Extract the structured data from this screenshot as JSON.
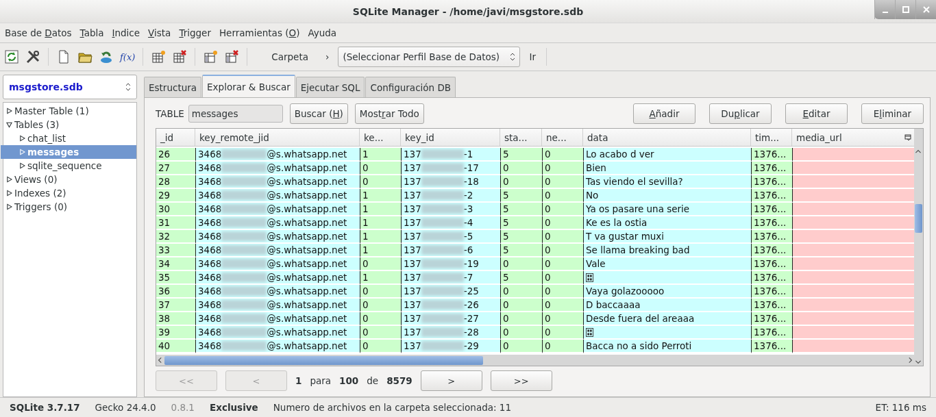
{
  "window": {
    "title": "SQLite Manager - /home/javi/msgstore.sdb"
  },
  "menu": [
    {
      "pre": "Base de ",
      "key": "D",
      "post": "atos"
    },
    {
      "key": "T",
      "post": "abla"
    },
    {
      "key": "I",
      "post": "ndice"
    },
    {
      "key": "V",
      "post": "ista"
    },
    {
      "key": "T",
      "post": "rigger"
    },
    {
      "pre": "Herramientas (",
      "key": "O",
      "post": ")"
    },
    {
      "pre": "Ayuda"
    }
  ],
  "toolbar": {
    "function_label": "f(x)",
    "folder_label": "Carpeta",
    "chevron": "›",
    "profile_select": "(Seleccionar Perfil Base de Datos)",
    "go_label": "Ir"
  },
  "sidebar": {
    "database": "msgstore.sdb",
    "tree": [
      {
        "label": "Master Table (1)",
        "expanded": false,
        "selected": false
      },
      {
        "label": "Tables (3)",
        "expanded": true,
        "selected": false,
        "children": [
          {
            "label": "chat_list",
            "expanded": false,
            "selected": false
          },
          {
            "label": "messages",
            "expanded": false,
            "selected": true
          },
          {
            "label": "sqlite_sequence",
            "expanded": false,
            "selected": false
          }
        ]
      },
      {
        "label": "Views (0)",
        "expanded": false,
        "selected": false
      },
      {
        "label": "Indexes (2)",
        "expanded": false,
        "selected": false
      },
      {
        "label": "Triggers (0)",
        "expanded": false,
        "selected": false
      }
    ]
  },
  "tabs": [
    {
      "label": "Estructura",
      "selected": false
    },
    {
      "label": "Explorar & Buscar",
      "selected": true
    },
    {
      "label": "Ejecutar SQL",
      "selected": false
    },
    {
      "label": "Configuración DB",
      "selected": false
    }
  ],
  "browse": {
    "table_label": "TABLE",
    "table_value": "messages",
    "left_buttons": [
      {
        "pre": "Buscar (",
        "key": "H",
        "post": ")"
      },
      {
        "pre": "Most",
        "key": "r",
        "post": "ar Todo"
      }
    ],
    "right_buttons": [
      {
        "key": "A",
        "post": "ñadir"
      },
      {
        "pre": "Du",
        "key": "p",
        "post": "licar"
      },
      {
        "key": "E",
        "post": "ditar"
      },
      {
        "pre": "E",
        "key": "l",
        "post": "iminar"
      }
    ]
  },
  "table": {
    "columns": [
      {
        "label": "_id",
        "color": "#ccffcc"
      },
      {
        "label": "key_remote_jid",
        "color": "#ccffff"
      },
      {
        "label": "ke...",
        "color": "#ccffcc"
      },
      {
        "label": "key_id",
        "color": "#ccffff"
      },
      {
        "label": "sta...",
        "color": "#ccffcc"
      },
      {
        "label": "ne...",
        "color": "#ccffcc"
      },
      {
        "label": "data",
        "color": "#ccffff"
      },
      {
        "label": "tim...",
        "color": "#ccffcc"
      },
      {
        "label": "media_url",
        "color": "#ffcccc"
      }
    ],
    "rows": [
      {
        "id": "26",
        "jid_start": "3468",
        "jid_end": "@s.whatsapp.net",
        "ke": "1",
        "key_start": "137",
        "key_end": "-1",
        "sta": "5",
        "ne": "0",
        "data": {
          "kind": "text",
          "text": "Lo acabo d ver"
        },
        "tim": "1376..."
      },
      {
        "id": "27",
        "jid_start": "3468",
        "jid_end": "@s.whatsapp.net",
        "ke": "0",
        "key_start": "137",
        "key_end": "-17",
        "sta": "0",
        "ne": "0",
        "data": {
          "kind": "text",
          "text": "Bien"
        },
        "tim": "1376..."
      },
      {
        "id": "28",
        "jid_start": "3468",
        "jid_end": "@s.whatsapp.net",
        "ke": "0",
        "key_start": "137",
        "key_end": "-18",
        "sta": "0",
        "ne": "0",
        "data": {
          "kind": "text",
          "text": "Tas viendo el sevilla?"
        },
        "tim": "1376..."
      },
      {
        "id": "29",
        "jid_start": "3468",
        "jid_end": "@s.whatsapp.net",
        "ke": "1",
        "key_start": "137",
        "key_end": "-2",
        "sta": "5",
        "ne": "0",
        "data": {
          "kind": "text",
          "text": "No"
        },
        "tim": "1376..."
      },
      {
        "id": "30",
        "jid_start": "3468",
        "jid_end": "@s.whatsapp.net",
        "ke": "1",
        "key_start": "137",
        "key_end": "-3",
        "sta": "5",
        "ne": "0",
        "data": {
          "kind": "text",
          "text": "Ya os pasare una serie"
        },
        "tim": "1376..."
      },
      {
        "id": "31",
        "jid_start": "3468",
        "jid_end": "@s.whatsapp.net",
        "ke": "1",
        "key_start": "137",
        "key_end": "-4",
        "sta": "5",
        "ne": "0",
        "data": {
          "kind": "text",
          "text": "Ke es la ostia"
        },
        "tim": "1376..."
      },
      {
        "id": "32",
        "jid_start": "3468",
        "jid_end": "@s.whatsapp.net",
        "ke": "1",
        "key_start": "137",
        "key_end": "-5",
        "sta": "5",
        "ne": "0",
        "data": {
          "kind": "text",
          "text": "T va gustar muxi"
        },
        "tim": "1376..."
      },
      {
        "id": "33",
        "jid_start": "3468",
        "jid_end": "@s.whatsapp.net",
        "ke": "1",
        "key_start": "137",
        "key_end": "-6",
        "sta": "5",
        "ne": "0",
        "data": {
          "kind": "text",
          "text": "Se llama breaking bad"
        },
        "tim": "1376..."
      },
      {
        "id": "34",
        "jid_start": "3468",
        "jid_end": "@s.whatsapp.net",
        "ke": "0",
        "key_start": "137",
        "key_end": "-19",
        "sta": "0",
        "ne": "0",
        "data": {
          "kind": "text",
          "text": "Vale"
        },
        "tim": "1376..."
      },
      {
        "id": "35",
        "jid_start": "3468",
        "jid_end": "@s.whatsapp.net",
        "ke": "1",
        "key_start": "137",
        "key_end": "-7",
        "sta": "5",
        "ne": "0",
        "data": {
          "kind": "glyph"
        },
        "tim": "1376..."
      },
      {
        "id": "36",
        "jid_start": "3468",
        "jid_end": "@s.whatsapp.net",
        "ke": "0",
        "key_start": "137",
        "key_end": "-25",
        "sta": "0",
        "ne": "0",
        "data": {
          "kind": "text",
          "text": "Vaya golazooooo"
        },
        "tim": "1376..."
      },
      {
        "id": "37",
        "jid_start": "3468",
        "jid_end": "@s.whatsapp.net",
        "ke": "0",
        "key_start": "137",
        "key_end": "-26",
        "sta": "0",
        "ne": "0",
        "data": {
          "kind": "text",
          "text": "D baccaaaa"
        },
        "tim": "1376..."
      },
      {
        "id": "38",
        "jid_start": "3468",
        "jid_end": "@s.whatsapp.net",
        "ke": "0",
        "key_start": "137",
        "key_end": "-27",
        "sta": "0",
        "ne": "0",
        "data": {
          "kind": "text",
          "text": "Desde fuera del areaaa"
        },
        "tim": "1376..."
      },
      {
        "id": "39",
        "jid_start": "3468",
        "jid_end": "@s.whatsapp.net",
        "ke": "0",
        "key_start": "137",
        "key_end": "-28",
        "sta": "0",
        "ne": "0",
        "data": {
          "kind": "glyph"
        },
        "tim": "1376..."
      },
      {
        "id": "40",
        "jid_start": "3468",
        "jid_end": "@s.whatsapp.net",
        "ke": "0",
        "key_start": "137",
        "key_end": "-29",
        "sta": "0",
        "ne": "0",
        "data": {
          "kind": "text",
          "text": "Bacca no a sido Perroti"
        },
        "tim": "1376..."
      }
    ]
  },
  "pager": {
    "first": {
      "label": "<<",
      "disabled": true
    },
    "prev": {
      "label": "<",
      "disabled": true
    },
    "from": "1",
    "para": "para",
    "to": "100",
    "de": "de",
    "total": "8579",
    "next": {
      "label": ">",
      "disabled": false
    },
    "last": {
      "label": ">>",
      "disabled": false
    }
  },
  "status_bar": {
    "items": [
      {
        "text": "SQLite 3.7.17",
        "kind": "bold"
      },
      {
        "text": "Gecko 24.4.0",
        "kind": "normal"
      },
      {
        "text": "0.8.1",
        "kind": "muted"
      },
      {
        "text": "Exclusive",
        "kind": "bold"
      },
      {
        "text": "Numero de archivos en la carpeta seleccionada: 11",
        "kind": "normal"
      }
    ],
    "elapsed": "ET: 116 ms"
  }
}
